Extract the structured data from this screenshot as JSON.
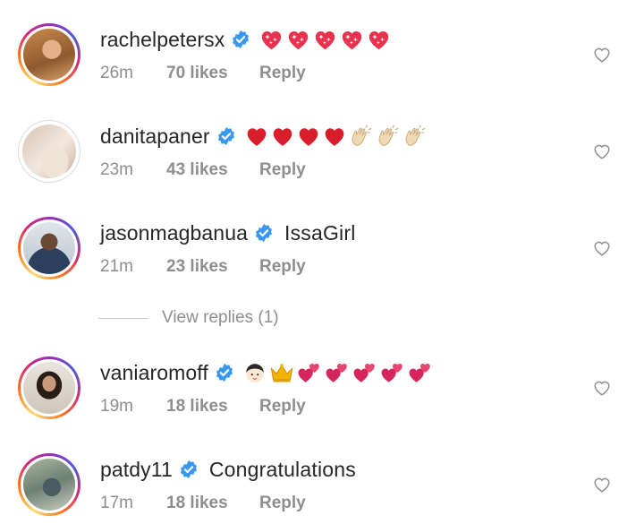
{
  "comments": [
    {
      "username": "rachelpetersx",
      "text": "",
      "emojis": [
        "sparkling-heart",
        "sparkling-heart",
        "sparkling-heart",
        "sparkling-heart",
        "sparkling-heart"
      ],
      "time": "26m",
      "likes": "70 likes",
      "reply": "Reply",
      "ring": "story"
    },
    {
      "username": "danitapaner",
      "text": "",
      "emojis": [
        "red-heart",
        "red-heart",
        "red-heart",
        "red-heart",
        "clap",
        "clap",
        "clap"
      ],
      "time": "23m",
      "likes": "43 likes",
      "reply": "Reply",
      "ring": "plain"
    },
    {
      "username": "jasonmagbanua",
      "text": "IssaGirl",
      "emojis": [],
      "time": "21m",
      "likes": "23 likes",
      "reply": "Reply",
      "ring": "story"
    },
    {
      "username": "vaniaromoff",
      "text": "",
      "emojis": [
        "baby-face",
        "crown",
        "two-hearts",
        "two-hearts",
        "two-hearts",
        "two-hearts",
        "two-hearts"
      ],
      "time": "19m",
      "likes": "18 likes",
      "reply": "Reply",
      "ring": "story"
    },
    {
      "username": "patdy11",
      "text": "Congratulations",
      "emojis": [],
      "time": "17m",
      "likes": "18 likes",
      "reply": "Reply",
      "ring": "story"
    }
  ],
  "view_replies": "View replies (1)",
  "colors": {
    "verified": "#3897f0",
    "secondary_text": "#8e8e8e",
    "primary_text": "#262626"
  }
}
